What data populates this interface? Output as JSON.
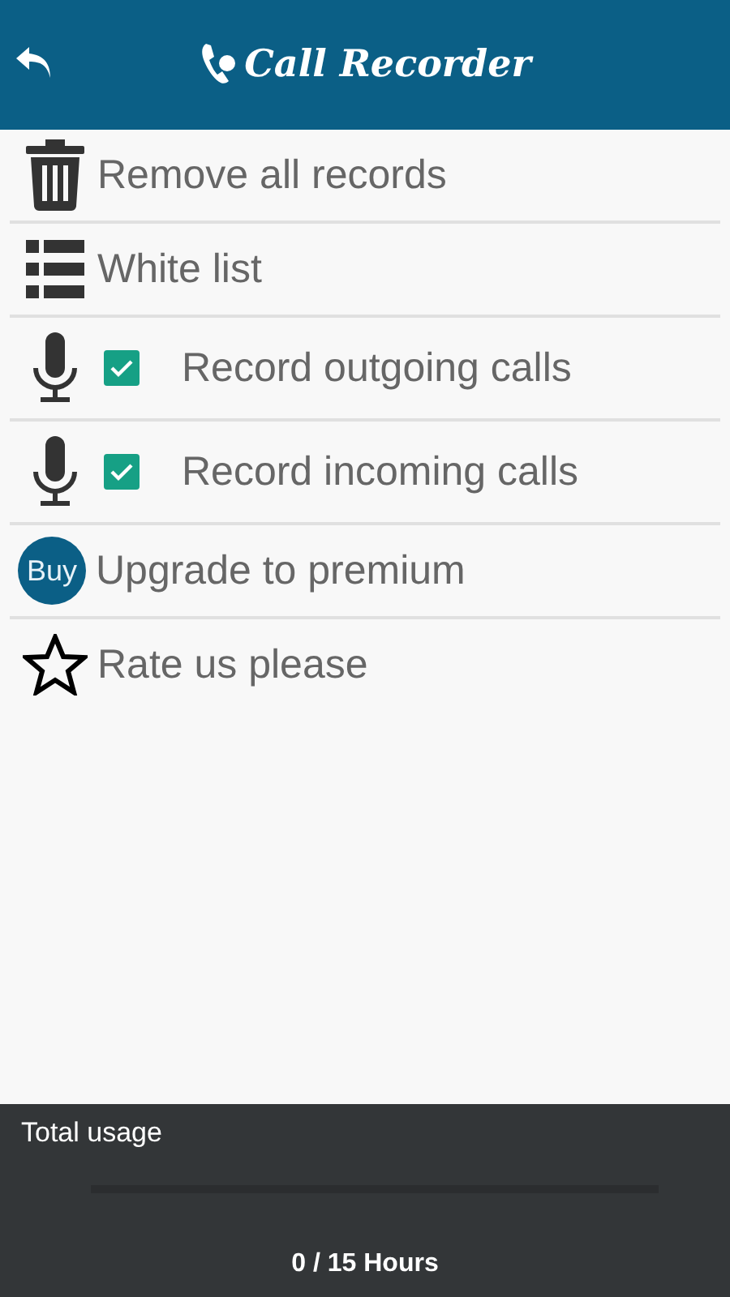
{
  "app_bar": {
    "title": "Call Recorder"
  },
  "menu": [
    {
      "kind": "trash",
      "label": "Remove all records"
    },
    {
      "kind": "list",
      "label": "White list"
    },
    {
      "kind": "mic",
      "label": "Record outgoing calls",
      "checked": true
    },
    {
      "kind": "mic",
      "label": "Record incoming calls",
      "checked": true
    },
    {
      "kind": "buy",
      "badge": "Buy",
      "label": "Upgrade to premium"
    },
    {
      "kind": "star",
      "label": "Rate us please"
    }
  ],
  "usage": {
    "title": "Total usage",
    "level": 0,
    "reading": "0 / 15 Hours"
  }
}
